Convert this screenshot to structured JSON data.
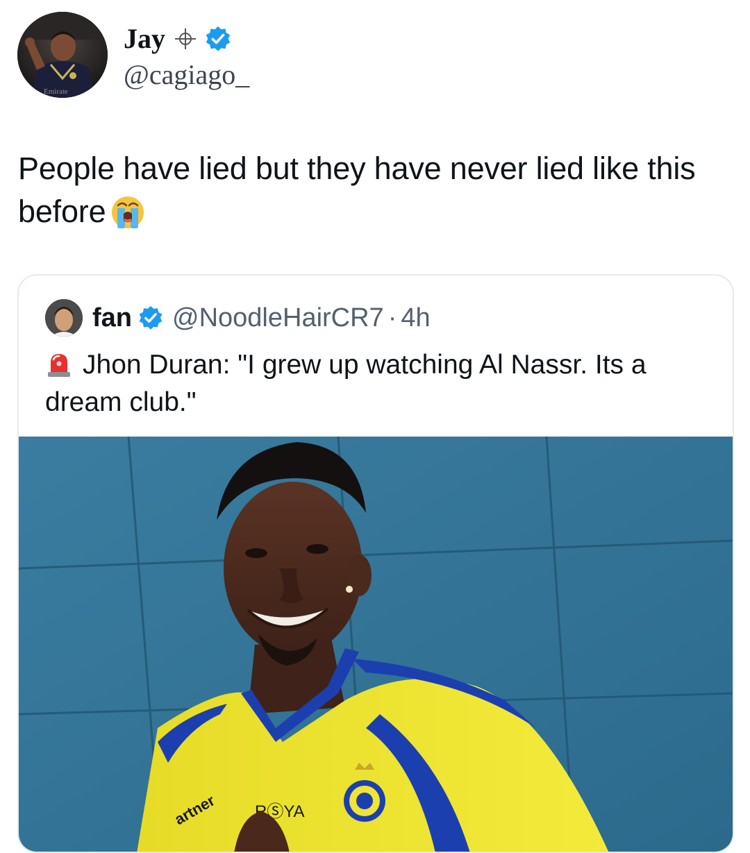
{
  "tweet": {
    "author": {
      "display_name": "Jay",
      "handle": "@cagiago_",
      "verified": true,
      "avatar_icon": "profile-photo",
      "name_badge_icon": "crosshair-icon"
    },
    "text": "People have lied but they have never lied like this before",
    "text_emoji": "loudly-crying-face-emoji",
    "accent_color": "#1d9bf0"
  },
  "quote": {
    "author": {
      "display_name": "fan",
      "handle": "@NoodleHairCR7",
      "separator": "·",
      "timestamp": "4h",
      "verified": true,
      "avatar_icon": "profile-photo"
    },
    "text_emoji": "police-car-light-emoji",
    "text": "Jhon Duran: \"I grew up watching Al Nassr. Its a dream club.\"",
    "media": {
      "type": "photo",
      "shirt_text_sponsor": "RⓈYA",
      "shirt_text_partner": "artner"
    }
  }
}
